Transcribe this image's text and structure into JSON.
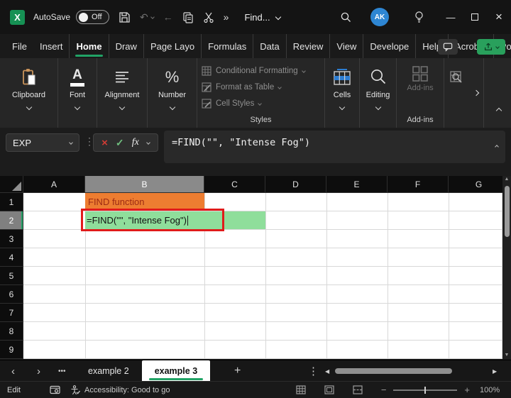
{
  "colors": {
    "accent_green": "#21A366",
    "avatar_blue": "#2E86D3",
    "b1_fill": "#ED7D31",
    "b1_text": "#9C2B13",
    "b2_fill": "#8FDE9B",
    "annotation_red": "#E01B1B"
  },
  "titlebar": {
    "autosave_label": "AutoSave",
    "autosave_state": "Off",
    "find_label": "Find...",
    "avatar_initials": "AK"
  },
  "glyphs": {
    "undo": "↶",
    "back_arrow": "←",
    "overflow": "»",
    "minimize": "—",
    "close": "×",
    "cancel": "×",
    "enter": "✓",
    "fx": "fx",
    "resizer_dots": "⋮",
    "menu_dots": "⋮",
    "more_sheets": "•••",
    "tab_prev": "‹",
    "tab_next": "›",
    "add_sheet": "+",
    "scroll_up": "▲",
    "scroll_down": "▼",
    "scroll_left": "◀",
    "scroll_right": "▶",
    "zoom_out": "−",
    "zoom_in": "+",
    "percent": "%",
    "font_letter": "A"
  },
  "ribbon_tabs": [
    {
      "label": "File"
    },
    {
      "label": "Insert"
    },
    {
      "label": "Home",
      "active": true
    },
    {
      "label": "Draw"
    },
    {
      "label": "Page Layo"
    },
    {
      "label": "Formulas"
    },
    {
      "label": "Data"
    },
    {
      "label": "Review"
    },
    {
      "label": "View"
    },
    {
      "label": "Develope"
    },
    {
      "label": "Help"
    },
    {
      "label": "Acrobat"
    },
    {
      "label": "Power Piv"
    }
  ],
  "ribbon": {
    "groups": [
      {
        "label": "Clipboard"
      },
      {
        "label": "Font"
      },
      {
        "label": "Alignment"
      },
      {
        "label": "Number"
      }
    ],
    "styles": {
      "items": [
        "Conditional Formatting",
        "Format as Table",
        "Cell Styles"
      ],
      "label": "Styles"
    },
    "cells_label": "Cells",
    "editing_label": "Editing",
    "addins_button_label": "Add-ins",
    "addins_group_label": "Add-ins"
  },
  "formula_bar": {
    "name_box_value": "EXP",
    "formula": "=FIND(\"\", \"Intense Fog\")"
  },
  "grid": {
    "column_headers": [
      {
        "label": "A"
      },
      {
        "label": "B",
        "selected": true
      },
      {
        "label": "C"
      },
      {
        "label": "D"
      },
      {
        "label": "E"
      },
      {
        "label": "F"
      },
      {
        "label": "G"
      }
    ],
    "row_headers": [
      {
        "label": "1"
      },
      {
        "label": "2",
        "selected": true
      },
      {
        "label": "3"
      },
      {
        "label": "4"
      },
      {
        "label": "5"
      },
      {
        "label": "6"
      },
      {
        "label": "7"
      },
      {
        "label": "8"
      },
      {
        "label": "9"
      }
    ],
    "cells": {
      "b1_text": "FIND function",
      "b2_text": "=FIND(\"\", \"Intense Fog\")"
    }
  },
  "sheet_bar": {
    "tabs": [
      {
        "label": "example 2"
      },
      {
        "label": "example 3",
        "active": true
      }
    ]
  },
  "status_bar": {
    "mode_label": "Edit",
    "accessibility_text": "Accessibility: Good to go",
    "zoom_level": "100%"
  }
}
